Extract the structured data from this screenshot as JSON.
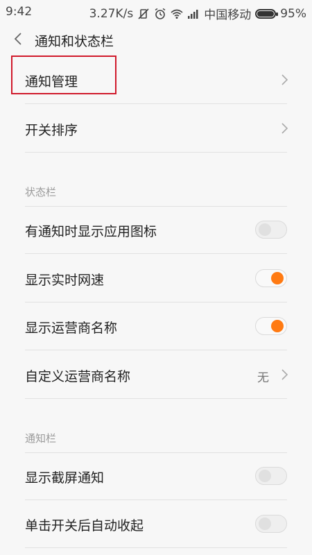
{
  "status_bar": {
    "time": "9:42",
    "speed": "3.27K/s",
    "carrier": "中国移动",
    "battery": "95%",
    "icons": [
      "vibrate-off-icon",
      "alarm-icon",
      "wifi-icon",
      "signal-icon",
      "battery-icon"
    ]
  },
  "header": {
    "title": "通知和状态栏",
    "back_icon": "chevron-left-icon"
  },
  "rows": {
    "notification_management": "通知管理",
    "switch_order": "开关排序",
    "show_app_icon": "有通知时显示应用图标",
    "show_net_speed": "显示实时网速",
    "show_carrier": "显示运营商名称",
    "custom_carrier": "自定义运营商名称",
    "custom_carrier_value": "无",
    "show_screenshot_notice": "显示截屏通知",
    "collapse_after_toggle": "单击开关后自动收起"
  },
  "sections": {
    "status_bar": "状态栏",
    "notification_bar": "通知栏"
  },
  "toggles": {
    "show_app_icon": false,
    "show_net_speed": true,
    "show_carrier": true,
    "show_screenshot_notice": false,
    "collapse_after_toggle": false
  },
  "colors": {
    "accent": "#ff7a12",
    "highlight": "#d0192b"
  }
}
